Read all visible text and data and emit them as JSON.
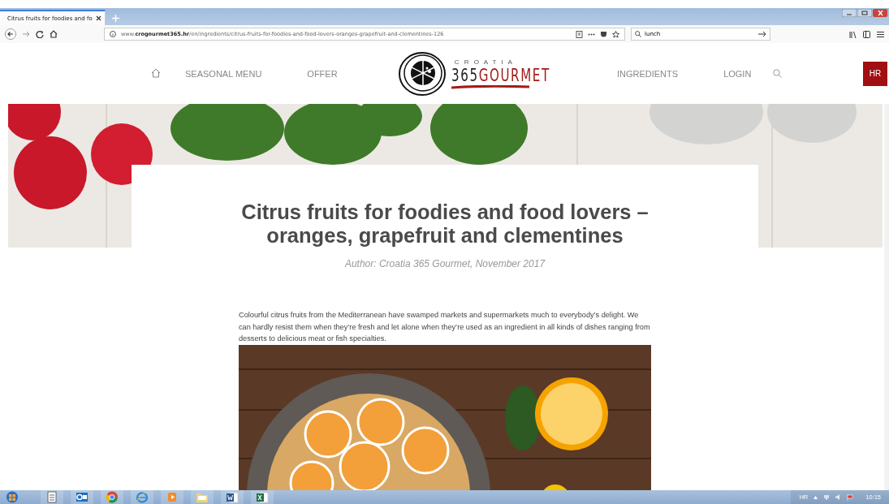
{
  "browser": {
    "tab_title": "Citrus fruits for foodies and fo",
    "url": "www.**crogourmet365.hr**/en/ingredients/citrus-fruits-for-foodies-and-food-lovers-oranges-grapefruit-and-clementines-126",
    "search_value": "lunch"
  },
  "site_header": {
    "nav_left": [
      {
        "label": "SEASONAL MENU"
      },
      {
        "label": "OFFER"
      }
    ],
    "logo": {
      "top": "C R O A T I A",
      "number": "365",
      "word": "GOURMET"
    },
    "nav_right": [
      {
        "label": "INGREDIENTS"
      },
      {
        "label": "LOGIN"
      }
    ],
    "language": "HR"
  },
  "article": {
    "title": "Citrus fruits for foodies and food lovers – oranges, grapefruit and clementines",
    "author": "Author: Croatia 365 Gourmet, November 2017",
    "intro": "Colourful citrus fruits from the Mediterranean have swamped markets and supermarkets much to everybody’s delight. We can hardly resist them when they’re fresh and let alone when they’re used as an ingredient in all kinds of dishes ranging from desserts to delicious meat or fish specialties."
  },
  "taskbar": {
    "apps": [
      {
        "kind": "start"
      },
      {
        "kind": "document"
      },
      {
        "kind": "mail"
      },
      {
        "kind": "chrome"
      },
      {
        "kind": "explorer"
      },
      {
        "kind": "player"
      },
      {
        "kind": "folder"
      },
      {
        "kind": "word"
      },
      {
        "kind": "excel"
      }
    ],
    "tray": {
      "language": "HR",
      "time": "10:15"
    }
  }
}
